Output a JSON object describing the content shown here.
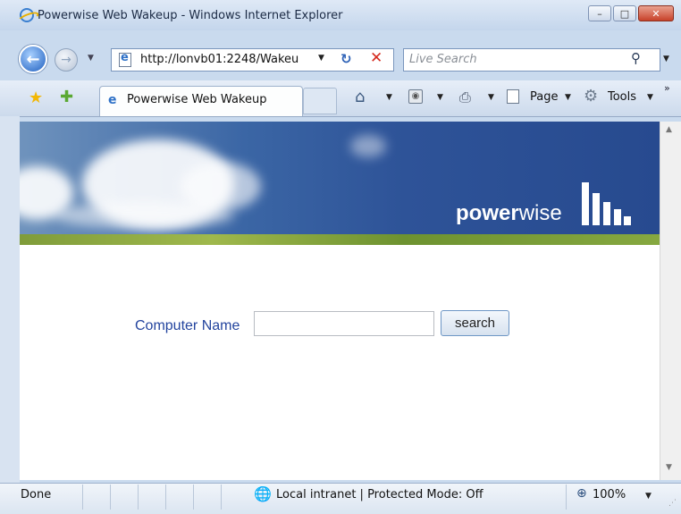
{
  "window": {
    "title": "Powerwise Web Wakeup - Windows Internet Explorer",
    "minimize_symbol": "–",
    "maximize_symbol": "□",
    "close_symbol": "✕"
  },
  "address_bar": {
    "url": "http://lonvb01:2248/Wakeu",
    "search_placeholder": "Live Search"
  },
  "toolbar": {
    "tab_label": "Powerwise Web Wakeup",
    "page_label": "Page",
    "tools_label": "Tools"
  },
  "banner": {
    "logo_bold": "power",
    "logo_light": "wise"
  },
  "form": {
    "label": "Computer Name",
    "input_value": "",
    "button_label": "search"
  },
  "statusbar": {
    "status": "Done",
    "zone": "Local intranet | Protected Mode: Off",
    "zoom": "100%"
  },
  "colors": {
    "link_blue": "#23449e",
    "banner_blue": "#2e5398",
    "grass_green": "#7f9c3a"
  }
}
